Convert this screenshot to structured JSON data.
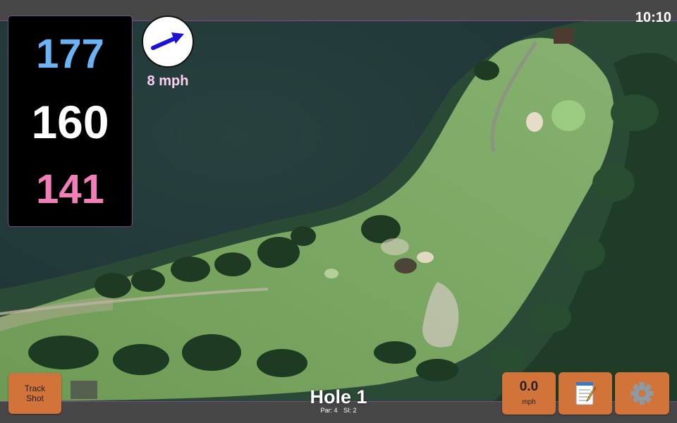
{
  "status": {
    "time": "10:10"
  },
  "distances": {
    "back": "177",
    "middle": "160",
    "front": "141"
  },
  "wind": {
    "speed_label": "8 mph",
    "icon": "wind-arrow-icon",
    "direction": "east-northeast"
  },
  "hole": {
    "title": "Hole 1",
    "par_label": "Par: 4",
    "si_label": "SI: 2"
  },
  "buttons": {
    "track_shot_line1": "Track",
    "track_shot_line2": "Shot",
    "speed_value": "0.0",
    "speed_unit": "mph",
    "notes_icon": "notepad-icon",
    "settings_icon": "gear-icon"
  },
  "colors": {
    "back_distance": "#6ab3f5",
    "middle_distance": "#ffffff",
    "front_distance": "#f07fb8",
    "button": "#d2743a",
    "wind_label": "#fbd0f4"
  }
}
